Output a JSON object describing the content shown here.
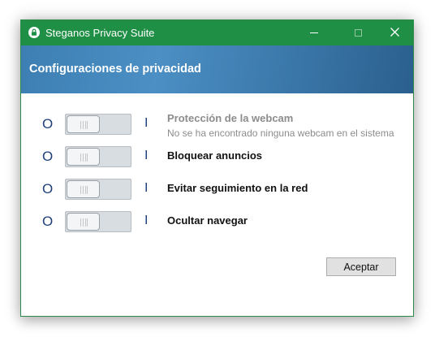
{
  "window": {
    "title": "Steganos Privacy Suite",
    "icon": "lock-icon",
    "controls": [
      "minimize-icon",
      "maximize-icon",
      "close-icon"
    ]
  },
  "banner": {
    "title": "Configuraciones de privacidad"
  },
  "settings": [
    {
      "state_off": "O",
      "state_on": "I",
      "title": "Protección de la webcam",
      "subtitle": "No se ha encontrado ninguna webcam en el sistema",
      "enabled": false,
      "toggle_on": false
    },
    {
      "state_off": "O",
      "state_on": "I",
      "title": "Bloquear anuncios",
      "enabled": true,
      "toggle_on": false
    },
    {
      "state_off": "O",
      "state_on": "I",
      "title": "Evitar seguimiento en la red",
      "enabled": true,
      "toggle_on": false
    },
    {
      "state_off": "O",
      "state_on": "I",
      "title": "Ocultar navegar",
      "enabled": true,
      "toggle_on": false
    }
  ],
  "footer": {
    "accept_label": "Aceptar"
  },
  "colors": {
    "titlebar": "#1f8f45",
    "banner": "#3d7fb3",
    "state_text": "#1e3f7a",
    "disabled_text": "#8c8c8c"
  }
}
